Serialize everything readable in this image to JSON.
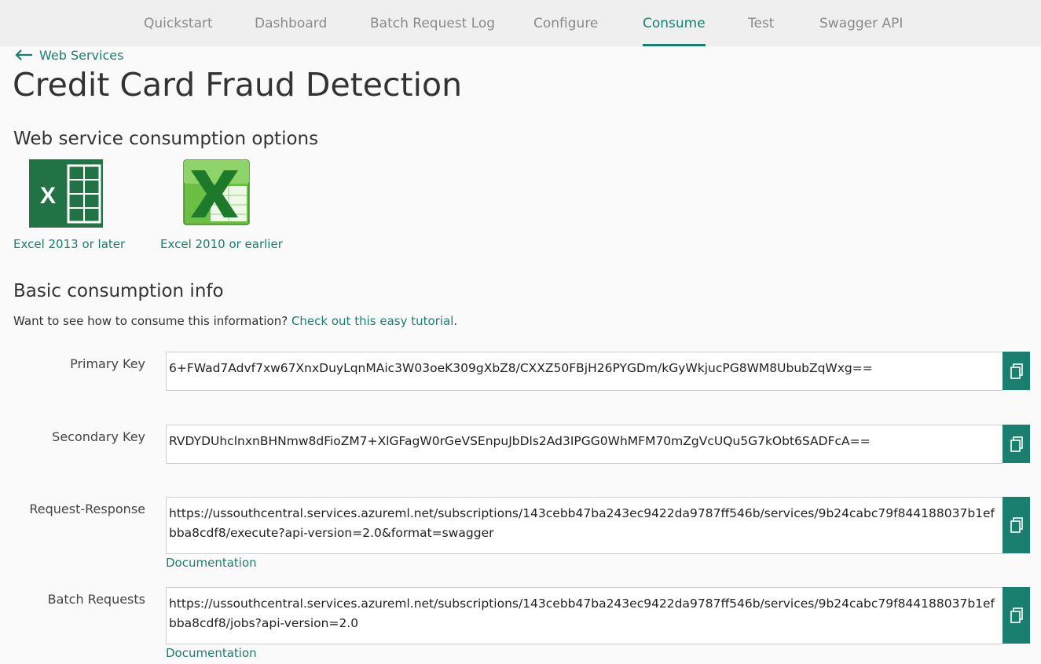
{
  "nav": {
    "tabs": [
      {
        "label": "Quickstart"
      },
      {
        "label": "Dashboard"
      },
      {
        "label": "Batch Request Log"
      },
      {
        "label": "Configure"
      },
      {
        "label": "Consume"
      },
      {
        "label": "Test"
      },
      {
        "label": "Swagger API"
      }
    ],
    "active_tab": "Consume"
  },
  "breadcrumb": {
    "back_label": "Web Services",
    "icon": "arrow-left-icon"
  },
  "page": {
    "title": "Credit Card Fraud Detection"
  },
  "consumption_options": {
    "heading": "Web service consumption options",
    "options": [
      {
        "label": "Excel 2013 or later",
        "icon": "excel-2013-icon"
      },
      {
        "label": "Excel 2010 or earlier",
        "icon": "excel-2010-icon"
      }
    ]
  },
  "basic_info": {
    "heading": "Basic consumption info",
    "description": "Want to see how to consume this information?",
    "tutorial_link": "Check out this easy tutorial",
    "tutorial_suffix": ".",
    "fields": [
      {
        "label": "Primary Key",
        "value": "6+FWad7Advf7xw67XnxDuyLqnMAic3W03oeK309gXbZ8/CXXZ50FBjH26PYGDm/kGyWkjucPG8WM8UbubZqWxg=="
      },
      {
        "label": "Secondary Key",
        "value": "RVDYDUhclnxnBHNmw8dFioZM7+XlGFagW0rGeVSEnpuJbDls2Ad3IPGG0WhMFM70mZgVcUQu5G7kObt6SADFcA=="
      },
      {
        "label": "Request-Response",
        "value": "https://ussouthcentral.services.azureml.net/subscriptions/143cebb47ba243ec9422da9787ff546b/services/9b24cabc79f844188037b1efbba8cdf8/execute?api-version=2.0&format=swagger",
        "doc_link": "Documentation"
      },
      {
        "label": "Batch Requests",
        "value": "https://ussouthcentral.services.azureml.net/subscriptions/143cebb47ba243ec9422da9787ff546b/services/9b24cabc79f844188037b1efbba8cdf8/jobs?api-version=2.0",
        "doc_link": "Documentation"
      }
    ],
    "copy_icon": "copy-icon"
  },
  "colors": {
    "accent": "#1a7f6e",
    "excel_green": "#217346"
  }
}
